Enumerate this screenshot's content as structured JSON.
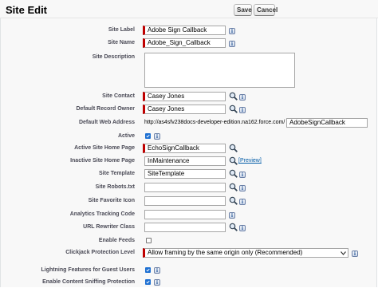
{
  "header": {
    "title": "Site Edit",
    "save_label": "Save",
    "cancel_label": "Cancel"
  },
  "fields": {
    "site_label": {
      "label": "Site Label",
      "value": "Adobe Sign Callback"
    },
    "site_name": {
      "label": "Site Name",
      "value": "Adobe_Sign_Callback"
    },
    "site_description": {
      "label": "Site Description",
      "value": ""
    },
    "site_contact": {
      "label": "Site Contact",
      "value": "Casey Jones"
    },
    "default_record_owner": {
      "label": "Default Record Owner",
      "value": "Casey Jones"
    },
    "default_web_address": {
      "label": "Default Web Address",
      "prefix": "http://as4sfv238docs-developer-edition.na162.force.com/",
      "value": "AdobeSignCallback"
    },
    "active": {
      "label": "Active",
      "checked": true
    },
    "active_site_home_page": {
      "label": "Active Site Home Page",
      "value": "EchoSignCallback"
    },
    "inactive_site_home_page": {
      "label": "Inactive Site Home Page",
      "value": "InMaintenance",
      "preview_label": "[Preview]"
    },
    "site_template": {
      "label": "Site Template",
      "value": "SiteTemplate"
    },
    "site_robots": {
      "label": "Site Robots.txt",
      "value": ""
    },
    "site_favorite_icon": {
      "label": "Site Favorite Icon",
      "value": ""
    },
    "analytics_tracking_code": {
      "label": "Analytics Tracking Code",
      "value": ""
    },
    "url_rewriter_class": {
      "label": "URL Rewriter Class",
      "value": ""
    },
    "enable_feeds": {
      "label": "Enable Feeds",
      "checked": false
    },
    "clickjack_protection_level": {
      "label": "Clickjack Protection Level",
      "value": "Allow framing by the same origin only (Recommended)"
    },
    "lightning_features_guest": {
      "label": "Lightning Features for Guest Users",
      "checked": true
    },
    "content_sniffing_protection": {
      "label": "Enable Content Sniffing Protection",
      "checked": true
    }
  },
  "icons": {
    "info": "info-icon",
    "lookup": "lookup-magnifier-icon",
    "dropdown": "chevron-down-icon"
  },
  "colors": {
    "required_bar": "#c00000",
    "header_border": "#1a5d8a",
    "link": "#015ba7",
    "checkbox": "#1e70d2"
  }
}
